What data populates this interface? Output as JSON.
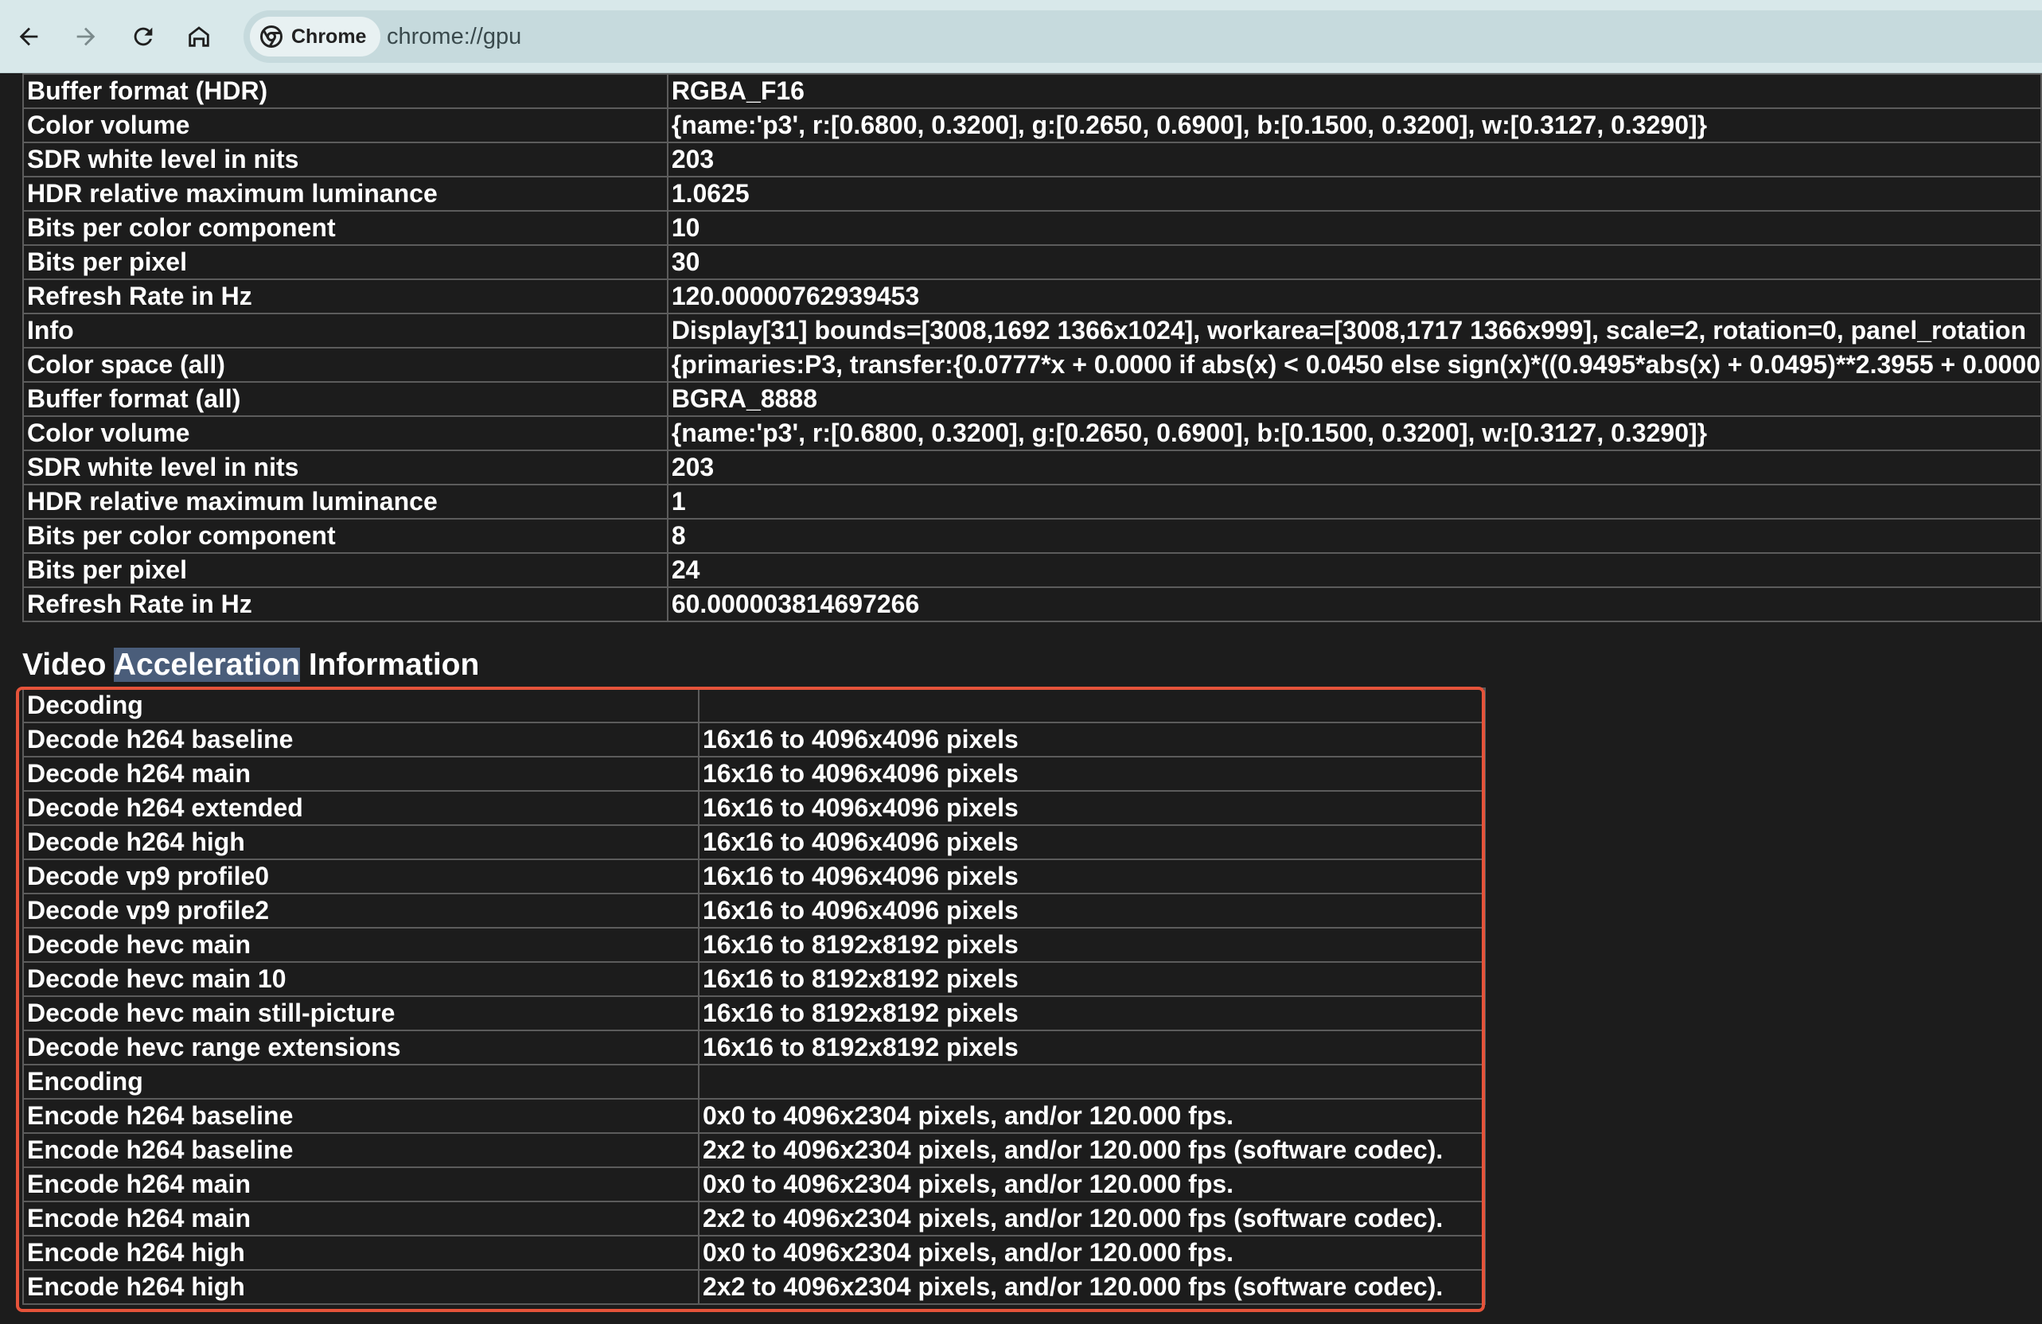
{
  "browser": {
    "chip_label": "Chrome",
    "url": "chrome://gpu"
  },
  "display_rows": [
    {
      "label": "Buffer format (HDR)",
      "value": "RGBA_F16"
    },
    {
      "label": "Color volume",
      "value": "{name:'p3', r:[0.6800, 0.3200], g:[0.2650, 0.6900], b:[0.1500, 0.3200], w:[0.3127, 0.3290]}"
    },
    {
      "label": "SDR white level in nits",
      "value": "203"
    },
    {
      "label": "HDR relative maximum luminance",
      "value": "1.0625"
    },
    {
      "label": "Bits per color component",
      "value": "10"
    },
    {
      "label": "Bits per pixel",
      "value": "30"
    },
    {
      "label": "Refresh Rate in Hz",
      "value": "120.00000762939453"
    },
    {
      "label": "Info",
      "value": "Display[31] bounds=[3008,1692 1366x1024], workarea=[3008,1717 1366x999], scale=2, rotation=0, panel_rotation"
    },
    {
      "label": "Color space (all)",
      "value": "{primaries:P3, transfer:{0.0777*x + 0.0000 if abs(x) < 0.0450 else sign(x)*((0.9495*abs(x) + 0.0495)**2.3955 + 0.0000"
    },
    {
      "label": "Buffer format (all)",
      "value": "BGRA_8888"
    },
    {
      "label": "Color volume",
      "value": "{name:'p3', r:[0.6800, 0.3200], g:[0.2650, 0.6900], b:[0.1500, 0.3200], w:[0.3127, 0.3290]}"
    },
    {
      "label": "SDR white level in nits",
      "value": "203"
    },
    {
      "label": "HDR relative maximum luminance",
      "value": "1"
    },
    {
      "label": "Bits per color component",
      "value": "8"
    },
    {
      "label": "Bits per pixel",
      "value": "24"
    },
    {
      "label": "Refresh Rate in Hz",
      "value": "60.000003814697266"
    }
  ],
  "video_section": {
    "heading_pre": "Video ",
    "heading_highlight": "Acceleration",
    "heading_post": " Information",
    "rows": [
      {
        "label": "Decoding",
        "value": ""
      },
      {
        "label": "Decode h264 baseline",
        "value": "16x16 to 4096x4096 pixels"
      },
      {
        "label": "Decode h264 main",
        "value": "16x16 to 4096x4096 pixels"
      },
      {
        "label": "Decode h264 extended",
        "value": "16x16 to 4096x4096 pixels"
      },
      {
        "label": "Decode h264 high",
        "value": "16x16 to 4096x4096 pixels"
      },
      {
        "label": "Decode vp9 profile0",
        "value": "16x16 to 4096x4096 pixels"
      },
      {
        "label": "Decode vp9 profile2",
        "value": "16x16 to 4096x4096 pixels"
      },
      {
        "label": "Decode hevc main",
        "value": "16x16 to 8192x8192 pixels"
      },
      {
        "label": "Decode hevc main 10",
        "value": "16x16 to 8192x8192 pixels"
      },
      {
        "label": "Decode hevc main still-picture",
        "value": "16x16 to 8192x8192 pixels"
      },
      {
        "label": "Decode hevc range extensions",
        "value": "16x16 to 8192x8192 pixels"
      },
      {
        "label": "Encoding",
        "value": ""
      },
      {
        "label": "Encode h264 baseline",
        "value": "0x0 to 4096x2304 pixels, and/or 120.000 fps."
      },
      {
        "label": "Encode h264 baseline",
        "value": "2x2 to 4096x2304 pixels, and/or 120.000 fps (software codec)."
      },
      {
        "label": "Encode h264 main",
        "value": "0x0 to 4096x2304 pixels, and/or 120.000 fps."
      },
      {
        "label": "Encode h264 main",
        "value": "2x2 to 4096x2304 pixels, and/or 120.000 fps (software codec)."
      },
      {
        "label": "Encode h264 high",
        "value": "0x0 to 4096x2304 pixels, and/or 120.000 fps."
      },
      {
        "label": "Encode h264 high",
        "value": "2x2 to 4096x2304 pixels, and/or 120.000 fps (software codec)."
      }
    ]
  },
  "colors": {
    "annotation_box": "#e5533a",
    "search_highlight": "#4a5d7a",
    "page_background": "#1c1c1c",
    "toolbar_background": "#d8e8ea"
  },
  "icons": [
    "back-arrow-icon",
    "forward-arrow-icon",
    "reload-icon",
    "home-icon",
    "chrome-logo-icon"
  ]
}
